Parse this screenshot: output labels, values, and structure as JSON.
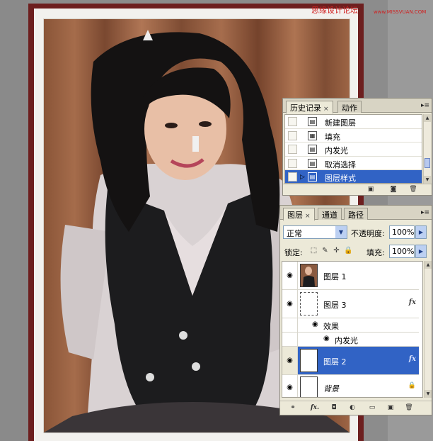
{
  "watermark": {
    "text": "思缘设计论坛",
    "url": "www.MISSVUAN.COM"
  },
  "history_panel": {
    "tabs": [
      {
        "label": "历史记录",
        "close": "×"
      },
      {
        "label": "动作"
      }
    ],
    "items": [
      {
        "label": "新建图层",
        "icon": "layer-step-icon"
      },
      {
        "label": "填充",
        "icon": "fill-step-icon"
      },
      {
        "label": "内发光",
        "icon": "layer-step-icon"
      },
      {
        "label": "取消选择",
        "icon": "layer-step-icon"
      },
      {
        "label": "图层样式",
        "icon": "layer-step-icon",
        "selected": true
      }
    ],
    "footer_icons": [
      "new-document-from-state-icon",
      "new-snapshot-icon",
      "trash-icon"
    ]
  },
  "layers_panel": {
    "tabs": [
      {
        "label": "图层",
        "close": "×"
      },
      {
        "label": "通道"
      },
      {
        "label": "路径"
      }
    ],
    "blend_mode": "正常",
    "opacity_label": "不透明度:",
    "opacity_value": "100%",
    "lock_label": "锁定:",
    "fill_label": "填充:",
    "fill_value": "100%",
    "layers": [
      {
        "name": "图层 1",
        "visible": true,
        "thumb": "photo"
      },
      {
        "name": "图层 3",
        "visible": true,
        "thumb": "transparent",
        "fx": "fx"
      },
      {
        "name": "效果",
        "type": "effects-header"
      },
      {
        "name": "内发光",
        "type": "effect"
      },
      {
        "name": "图层 2",
        "visible": true,
        "thumb": "white",
        "fx": "fx",
        "selected": true
      },
      {
        "name": "背景",
        "visible": true,
        "thumb": "white",
        "locked": true
      }
    ],
    "fx_footer_label": "fx."
  },
  "colors": {
    "frame": "#6d1f1f",
    "panel_bg": "#ece9d8",
    "selection": "#3163c5",
    "watermark": "#d02020"
  }
}
